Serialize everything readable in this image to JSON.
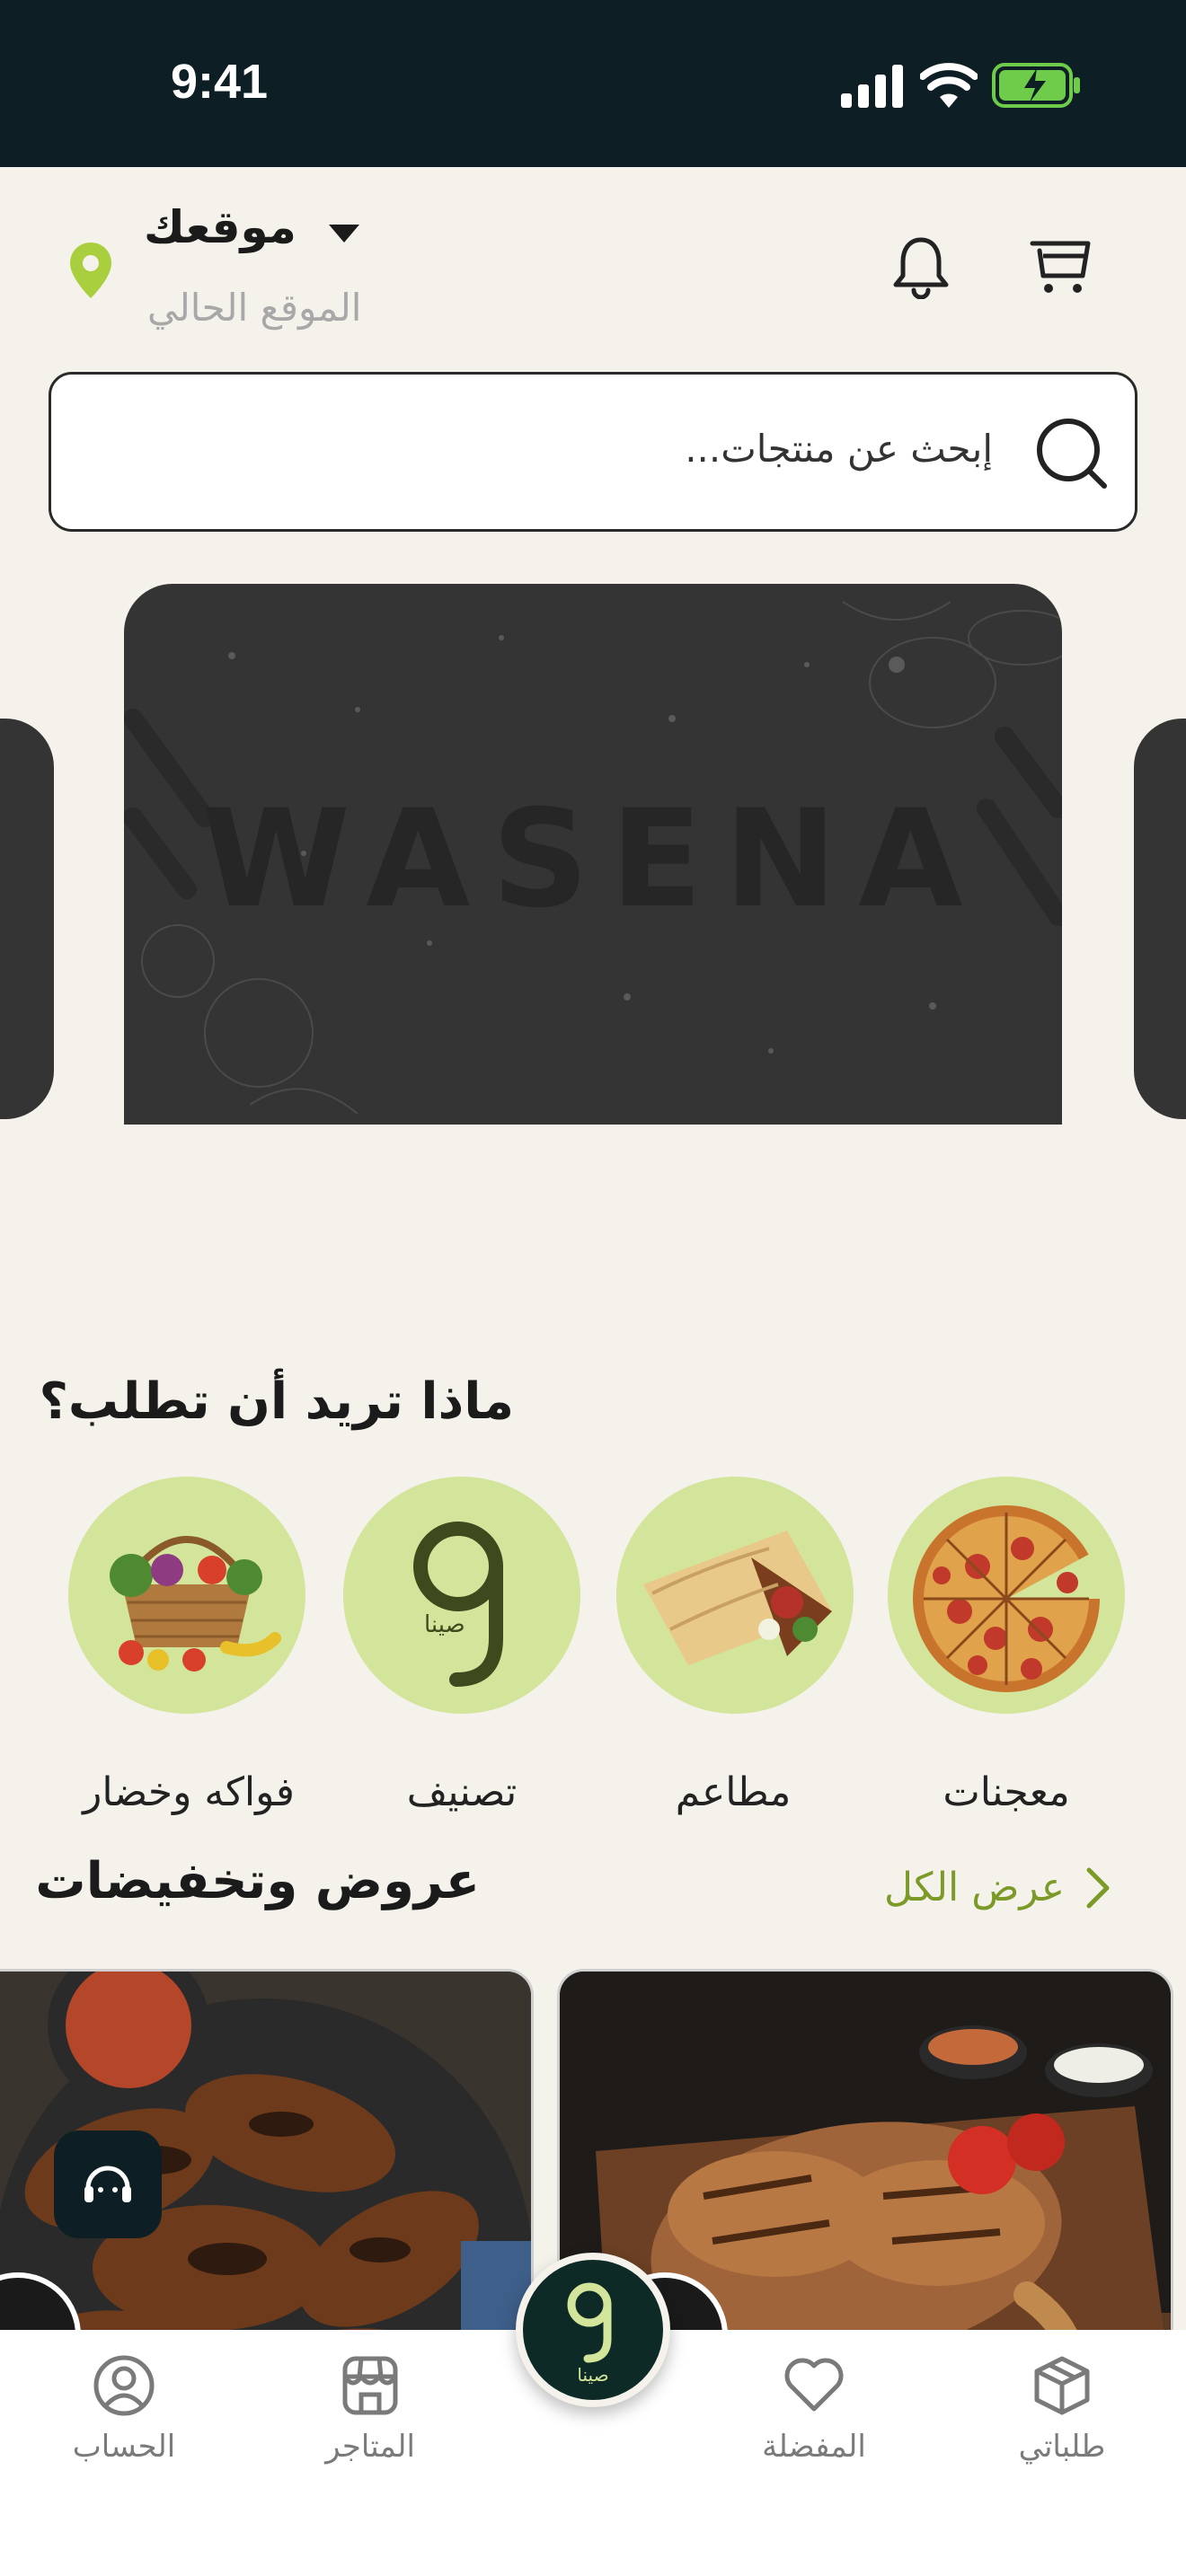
{
  "status_bar": {
    "time": "9:41"
  },
  "header": {
    "location_title": "موقعك",
    "location_subtitle": "الموقع الحالي",
    "location_icon": "location-pin-icon",
    "bell_icon": "bell-icon",
    "cart_icon": "cart-icon"
  },
  "search": {
    "placeholder": "إبحث عن منتجات..."
  },
  "banner": {
    "brand_text": "WASENA"
  },
  "categories": {
    "title": "ماذا تريد أن تطلب؟",
    "items": [
      {
        "label": "معجنات"
      },
      {
        "label": "مطاعم"
      },
      {
        "label": "تصنيف",
        "logo_sub": "صينا"
      },
      {
        "label": "فواكه وخضار"
      }
    ]
  },
  "offers": {
    "title": "عروض وتخفيضات",
    "see_all": "عرض الكل"
  },
  "bottom_nav": {
    "items": [
      {
        "label": "الحساب",
        "icon": "user-icon"
      },
      {
        "label": "المتاجر",
        "icon": "store-icon"
      },
      {
        "label": "المفضلة",
        "icon": "heart-icon"
      },
      {
        "label": "طلباتي",
        "icon": "box-icon"
      }
    ],
    "fab_sub": "صينا"
  },
  "colors": {
    "brand_dark": "#0D1F24",
    "accent_green": "#D3E59B",
    "link_green": "#7C9A27",
    "background": "#F4F2EB"
  }
}
